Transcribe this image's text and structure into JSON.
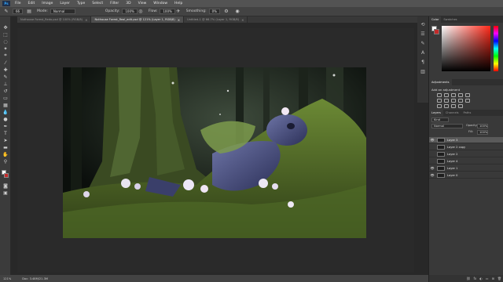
{
  "app": {
    "logo": "Ps"
  },
  "menu": [
    "File",
    "Edit",
    "Image",
    "Layer",
    "Type",
    "Select",
    "Filter",
    "3D",
    "View",
    "Window",
    "Help"
  ],
  "options": {
    "brush_size": "66",
    "mode_label": "Mode:",
    "mode_value": "Normal",
    "opacity_label": "Opacity:",
    "opacity_value": "100%",
    "flow_label": "Flow:",
    "flow_value": "100%",
    "smoothing_label": "Smoothing:",
    "smoothing_value": "0%"
  },
  "tabs": [
    {
      "label": "Nuthouse Forest_Redo.psd @ 100% (RGB/8)",
      "active": false
    },
    {
      "label": "Nuthouse Forest_Real_edit.psd @ 121% (Layer 1, RGB/8)",
      "active": true
    },
    {
      "label": "Untitled-1 @ 66.7% (Layer 1, RGB/8)",
      "active": false
    }
  ],
  "status": {
    "zoom": "121%",
    "doc_info": "Doc: 3.48M/21.3M"
  },
  "color_panel": {
    "tabs": [
      "Color",
      "Swatches"
    ],
    "fg": "#ffffff",
    "bg": "#c42a2a"
  },
  "adjustments_panel": {
    "tab": "Adjustments",
    "title": "Add an adjustment"
  },
  "layers_panel": {
    "tabs": [
      "Layers",
      "Channels",
      "Paths"
    ],
    "kind": "Kind",
    "blend_mode": "Normal",
    "opacity_label": "Opacity:",
    "opacity_value": "100%",
    "fill_label": "Fill:",
    "fill_value": "100%",
    "layers": [
      {
        "name": "Layer 3",
        "visible": true,
        "selected": true
      },
      {
        "name": "Layer 2 copy",
        "visible": false,
        "selected": false
      },
      {
        "name": "Layer 2",
        "visible": false,
        "selected": false
      },
      {
        "name": "Layer 4",
        "visible": false,
        "selected": false
      },
      {
        "name": "Layer 1",
        "visible": true,
        "selected": false
      },
      {
        "name": "Layer 0",
        "visible": true,
        "selected": false
      }
    ]
  }
}
